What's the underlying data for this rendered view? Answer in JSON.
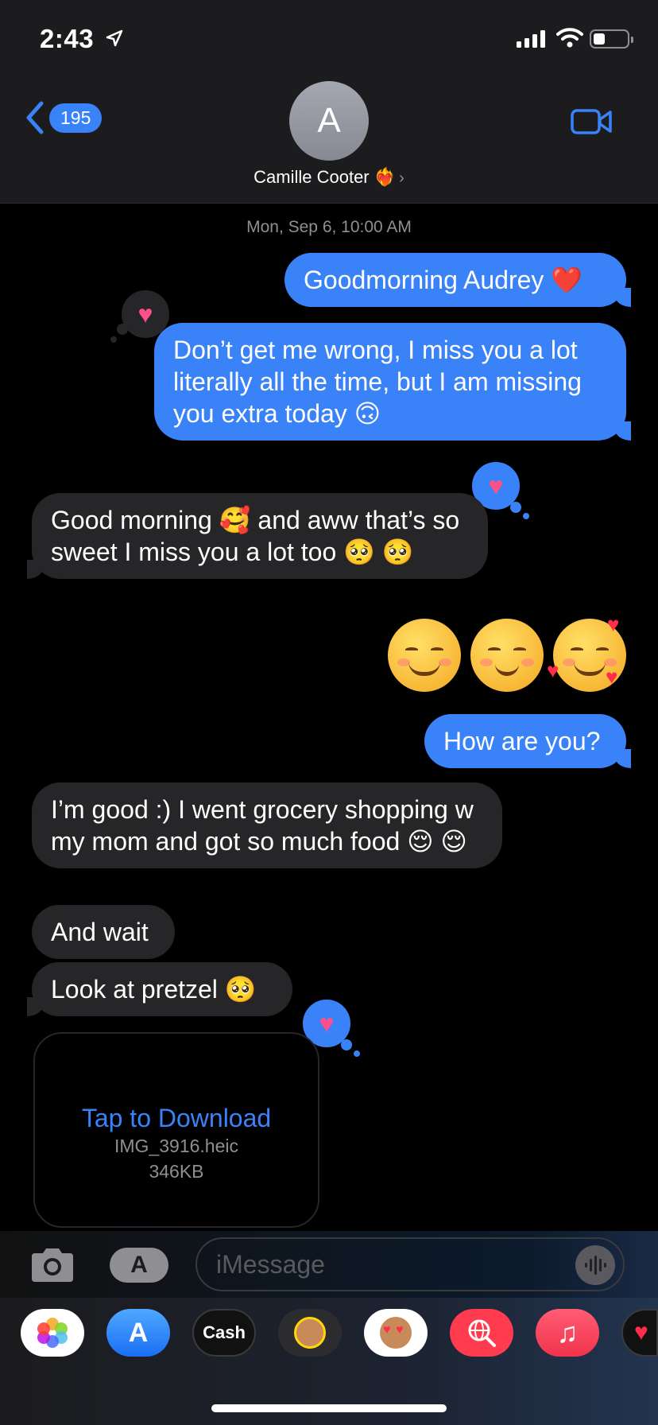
{
  "status_bar": {
    "time": "2:43"
  },
  "header": {
    "back_badge": "195",
    "avatar_initial": "A",
    "contact_name": "Camille Cooter",
    "contact_emoji": "❤️‍🔥"
  },
  "conversation": {
    "timestamp": "Mon, Sep 6, 10:00 AM",
    "messages": [
      {
        "from": "me",
        "text": "Goodmorning Audrey ❤️"
      },
      {
        "from": "me",
        "text": "Don’t get me wrong, I miss you a lot literally all the time, but I am missing you extra today 🙃",
        "tapback": "heart"
      },
      {
        "from": "them",
        "text": "Good morning 🥰 and aww that’s so sweet I miss you a lot too 🥺 🥺",
        "tapback": "heart"
      },
      {
        "from": "me",
        "big_emoji": "😊☺️🥰"
      },
      {
        "from": "me",
        "text": "How are you?"
      },
      {
        "from": "them",
        "text": "I’m good :) I went grocery shopping w my mom and got so much food 😌 😌"
      },
      {
        "from": "them",
        "text": "And wait"
      },
      {
        "from": "them",
        "text": "Look at pretzel 🥺",
        "tapback": "heart"
      }
    ],
    "attachment": {
      "action": "Tap to Download",
      "filename": "IMG_3916.heic",
      "size": "346KB"
    }
  },
  "input": {
    "placeholder": "iMessage"
  },
  "app_drawer": {
    "apps": [
      {
        "name": "photos-app-icon"
      },
      {
        "name": "app-store-app-icon"
      },
      {
        "name": "cash-app-icon",
        "label": "Cash"
      },
      {
        "name": "memoji-app-icon"
      },
      {
        "name": "animoji-stickers-app-icon"
      },
      {
        "name": "images-search-app-icon"
      },
      {
        "name": "music-app-icon"
      },
      {
        "name": "digital-touch-app-icon"
      }
    ]
  },
  "colors": {
    "accent": "#3a82f7",
    "incoming": "#262628",
    "tapback_heart": "#ff4f8b"
  }
}
